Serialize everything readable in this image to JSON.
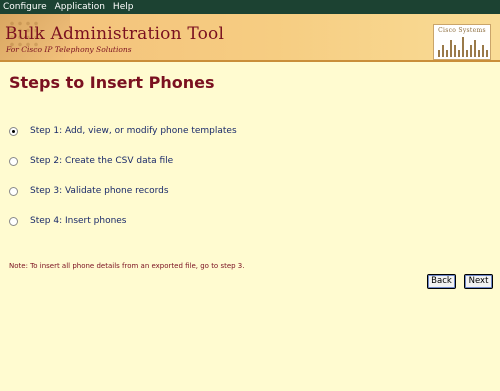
{
  "menu": {
    "items": [
      "Configure",
      "Application",
      "Help"
    ]
  },
  "banner": {
    "title": "Bulk Administration Tool",
    "subtitle": "For Cisco IP Telephony Solutions",
    "logo_text": "Cisco Systems"
  },
  "page": {
    "title": "Steps to Insert Phones"
  },
  "steps": [
    {
      "label": "Step 1: Add, view, or modify phone templates",
      "selected": true
    },
    {
      "label": "Step 2: Create the CSV data file",
      "selected": false
    },
    {
      "label": "Step 3: Validate phone records",
      "selected": false
    },
    {
      "label": "Step 4: Insert phones",
      "selected": false
    }
  ],
  "note": "Note: To insert all phone details from an exported file, go to step 3.",
  "buttons": {
    "back": "Back",
    "next": "Next"
  },
  "colors": {
    "menubar": "#1c4232",
    "title": "#7a1020",
    "background": "#fffbd0",
    "step_text": "#1a2a6a"
  }
}
